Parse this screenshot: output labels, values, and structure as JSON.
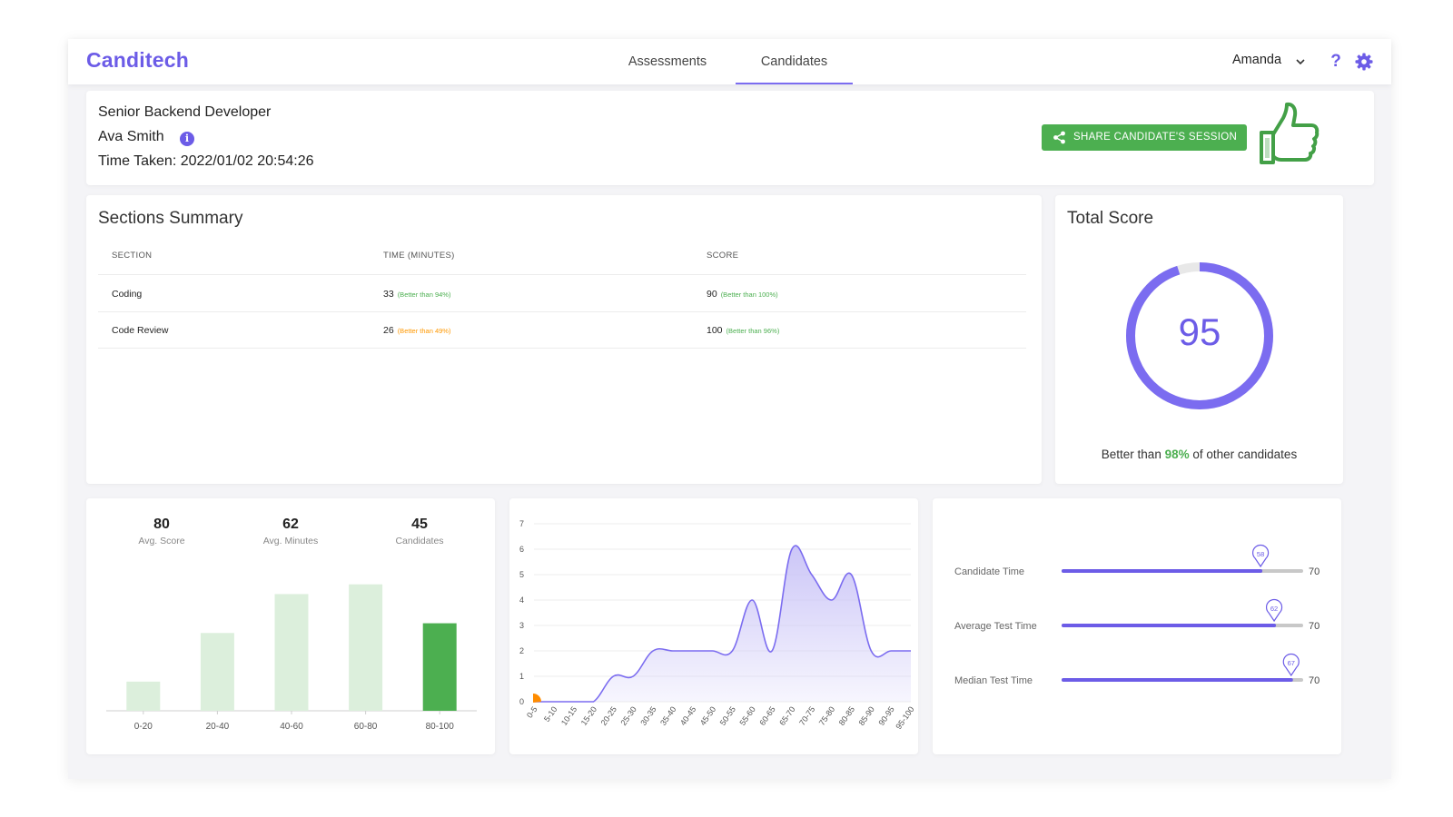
{
  "app": {
    "logo": "Canditech"
  },
  "nav": {
    "tabs": [
      {
        "label": "Assessments",
        "active": false
      },
      {
        "label": "Candidates",
        "active": true
      }
    ],
    "user": "Amanda",
    "help": "?"
  },
  "candidate": {
    "position": "Senior Backend Developer",
    "name": "Ava Smith",
    "time_taken": "Time Taken: 2022/01/02 20:54:26",
    "share_label": "SHARE CANDIDATE'S SESSION",
    "verdict_icon": "thumbs-up-icon"
  },
  "sections": {
    "title": "Sections Summary",
    "headers": [
      "SECTION",
      "TIME (MINUTES)",
      "SCORE"
    ],
    "rows": [
      {
        "section": "Coding",
        "time": "33",
        "time_note": "(Better than 94%)",
        "time_note_color": "green",
        "score": "90",
        "score_note": "(Better than 100%)",
        "score_note_color": "green"
      },
      {
        "section": "Code Review",
        "time": "26",
        "time_note": "(Better than 49%)",
        "time_note_color": "orange",
        "score": "100",
        "score_note": "(Better than 96%)",
        "score_note_color": "green"
      }
    ]
  },
  "total_score": {
    "title": "Total Score",
    "score": "95",
    "score_value": 95,
    "better_prefix": "Better than ",
    "better_pct": "98%",
    "better_suffix": " of other candidates"
  },
  "summary_stats": [
    {
      "value": "80",
      "label": "Avg. Score"
    },
    {
      "value": "62",
      "label": "Avg. Minutes"
    },
    {
      "value": "45",
      "label": "Candidates"
    }
  ],
  "chart_data": [
    {
      "type": "bar",
      "categories": [
        "0-20",
        "20-40",
        "40-60",
        "60-80",
        "80-100"
      ],
      "values": [
        3,
        8,
        12,
        13,
        9
      ],
      "highlight_index": 4,
      "colors": {
        "normal": "#dcefdc",
        "highlight": "#4caf50"
      }
    },
    {
      "type": "area",
      "categories": [
        "0-5",
        "5-10",
        "10-15",
        "15-20",
        "20-25",
        "25-30",
        "30-35",
        "35-40",
        "40-45",
        "45-50",
        "50-55",
        "55-60",
        "60-65",
        "65-70",
        "70-75",
        "75-80",
        "80-85",
        "85-90",
        "90-95",
        "95-100"
      ],
      "values": [
        0,
        0,
        0,
        0,
        1,
        1,
        2,
        2,
        2,
        2,
        2,
        4,
        2,
        6,
        5,
        4,
        5,
        2,
        2,
        2
      ],
      "yticks": [
        0,
        1,
        2,
        3,
        4,
        5,
        6,
        7
      ],
      "ylim": [
        0,
        7
      ],
      "marker_index": 0,
      "colors": {
        "line": "#7b6cf0",
        "fill": "#c9c3f7",
        "marker": "#ff8c00"
      }
    },
    {
      "type": "bar",
      "orientation": "horizontal",
      "categories": [
        "Candidate Time",
        "Average Test Time",
        "Median Test Time"
      ],
      "values": [
        58,
        62,
        67
      ],
      "max": 70,
      "max_label": "70",
      "colors": {
        "fill": "#6c5ce7",
        "track": "#c8c8c8"
      }
    }
  ],
  "colors": {
    "accent": "#6c5ce7",
    "success": "#4caf50",
    "warning": "#ff9800"
  }
}
